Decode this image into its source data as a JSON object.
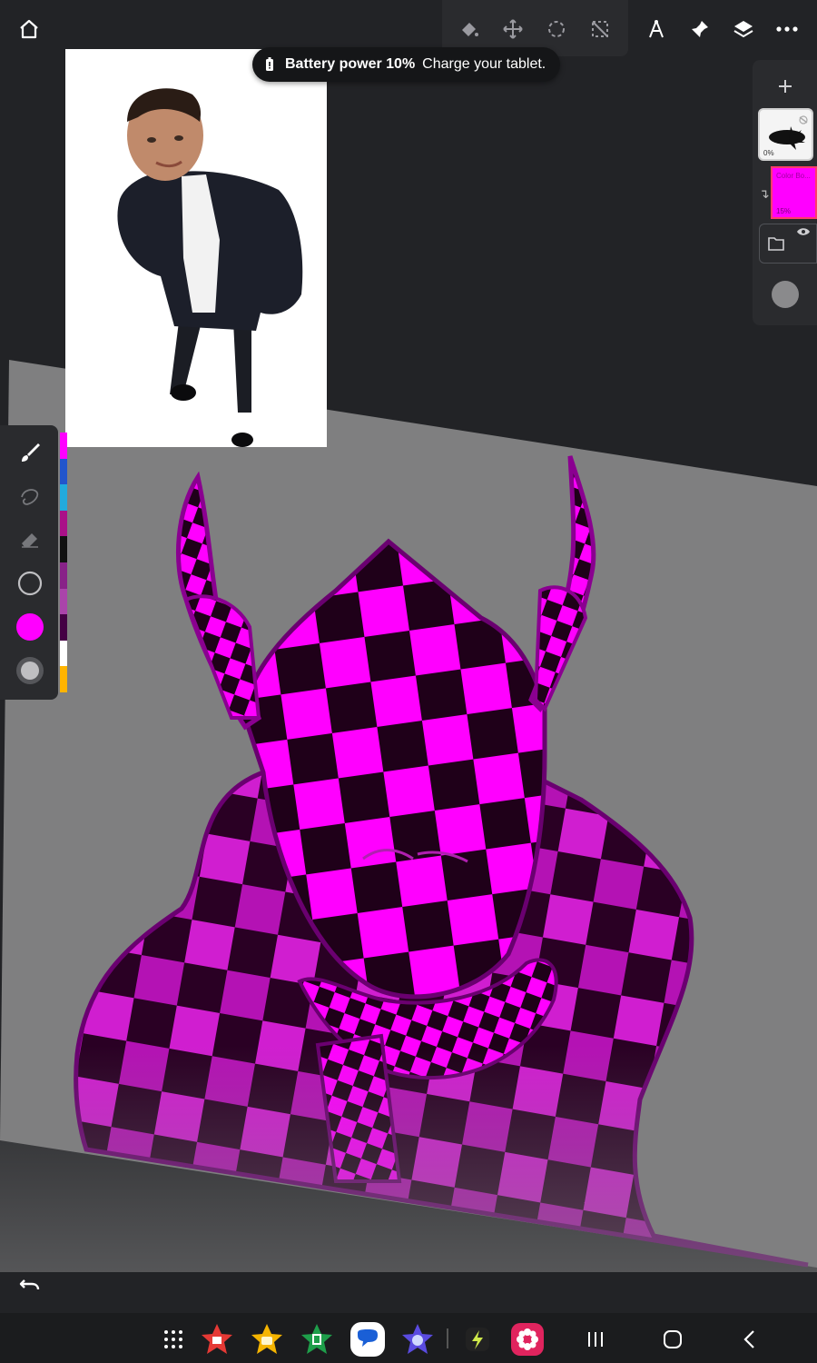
{
  "toolbar": {
    "home": "home-icon",
    "tools": [
      "fill-icon",
      "move-icon",
      "lasso-select-icon",
      "transform-icon",
      "ruler-icon",
      "pin-icon",
      "layers-icon",
      "more-icon"
    ]
  },
  "toast": {
    "bold_text": "Battery power 10%",
    "text": "Charge your tablet."
  },
  "layers": {
    "add_icon": "plus-icon",
    "items": [
      {
        "name": "",
        "opacity": "0%",
        "thumbnail": "ink-splat"
      },
      {
        "name": "Color Bo...",
        "opacity": "15%",
        "thumbnail": "magenta-fill",
        "selected": true
      }
    ],
    "group_icon": "folder-icon",
    "visibility_icon": "eye-icon"
  },
  "left_tools": {
    "items": [
      "brush-icon",
      "smudge-icon",
      "eraser-icon",
      "brush-size-icon",
      "color-swatch",
      "opacity-dot"
    ],
    "current_color": "#ff00ff",
    "palette": [
      "#ff00ff",
      "#2255cc",
      "#22aadd",
      "#aa1188",
      "#111111",
      "#882288",
      "#aa44aa",
      "#440044",
      "#ffffff",
      "#ffb400"
    ]
  },
  "canvas": {
    "background": "#7f7f80",
    "primary_color": "#ff00ff",
    "dark_color": "#1e0018"
  },
  "bottom": {
    "undo": "undo-icon",
    "apps": [
      "app-drawer-icon",
      "red-star-app",
      "yellow-star-app",
      "green-star-app",
      "messages-app",
      "blue-star-app",
      "energy-app",
      "flower-app"
    ],
    "nav": [
      "recents-icon",
      "home-circle-icon",
      "back-icon"
    ]
  }
}
